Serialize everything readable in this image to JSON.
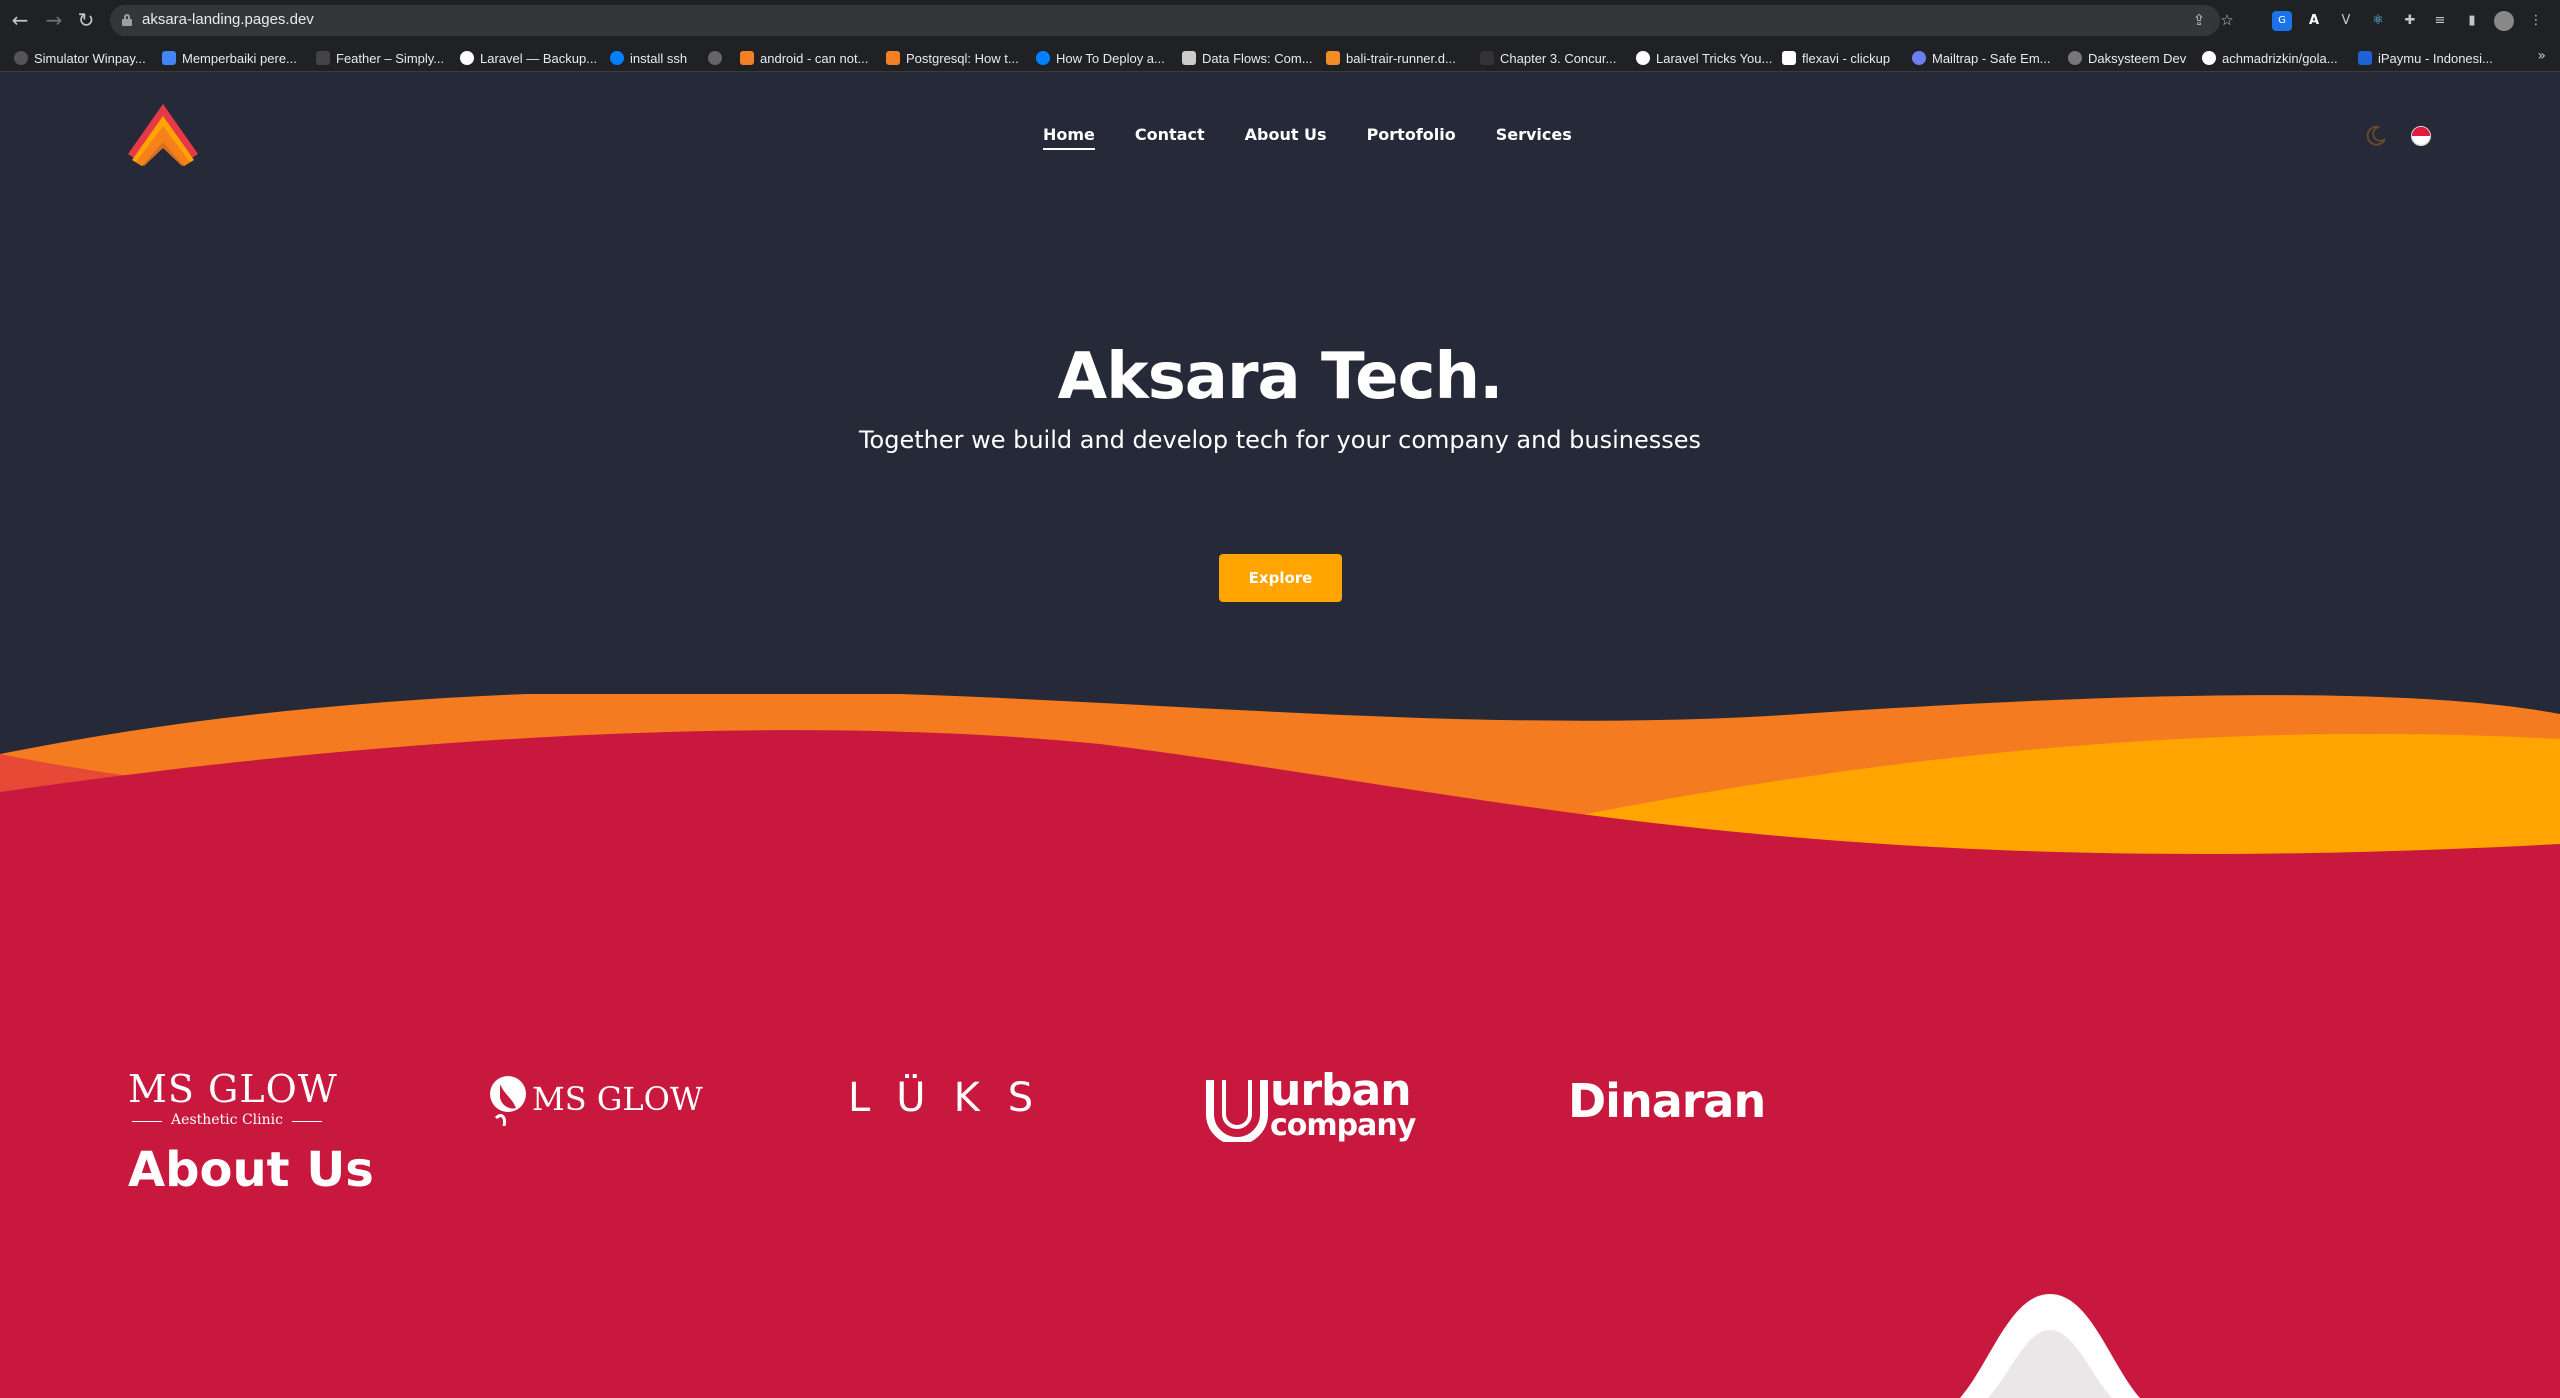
{
  "browser": {
    "url": "aksara-landing.pages.dev",
    "bookmarks": [
      {
        "label": "Simulator Winpay..."
      },
      {
        "label": "Memperbaiki pere..."
      },
      {
        "label": "Feather – Simply..."
      },
      {
        "label": "Laravel — Backup..."
      },
      {
        "label": "install ssh"
      },
      {
        "label": ""
      },
      {
        "label": "android - can not..."
      },
      {
        "label": "Postgresql: How t..."
      },
      {
        "label": "How To Deploy a..."
      },
      {
        "label": "Data Flows: Com..."
      },
      {
        "label": "bali-trair-runner.d..."
      },
      {
        "label": "Chapter 3. Concur..."
      },
      {
        "label": "Laravel Tricks You..."
      },
      {
        "label": "flexavi - clickup"
      },
      {
        "label": "Mailtrap - Safe Em..."
      },
      {
        "label": "Daksysteem Dev"
      },
      {
        "label": "achmadrizkin/gola..."
      },
      {
        "label": "iPaymu - Indonesi..."
      }
    ],
    "more": "»"
  },
  "nav": {
    "items": [
      {
        "label": "Home",
        "active": true
      },
      {
        "label": "Contact"
      },
      {
        "label": "About Us"
      },
      {
        "label": "Portofolio"
      },
      {
        "label": "Services"
      }
    ]
  },
  "hero": {
    "title": "Aksara Tech.",
    "subtitle": "Together we build and develop tech for your company and businesses",
    "cta": "Explore"
  },
  "clients": {
    "msglow_clinic": {
      "name": "MS GLOW",
      "sub": "Aesthetic Clinic"
    },
    "msglow": {
      "name": "MS GLOW"
    },
    "luks": {
      "name": "LÜKS"
    },
    "urban": {
      "name": "urban",
      "sub": "company"
    },
    "dinaran": {
      "name": "Dinaran"
    }
  },
  "about": {
    "title": "About Us"
  },
  "colors": {
    "page_bg": "#262a38",
    "accent": "#ffa400",
    "orange": "#f47b20",
    "red_orange": "#e64a37",
    "crimson": "#c8183e"
  },
  "icons": {
    "theme_toggle": "moon-icon",
    "language": "indonesia-flag-icon"
  }
}
